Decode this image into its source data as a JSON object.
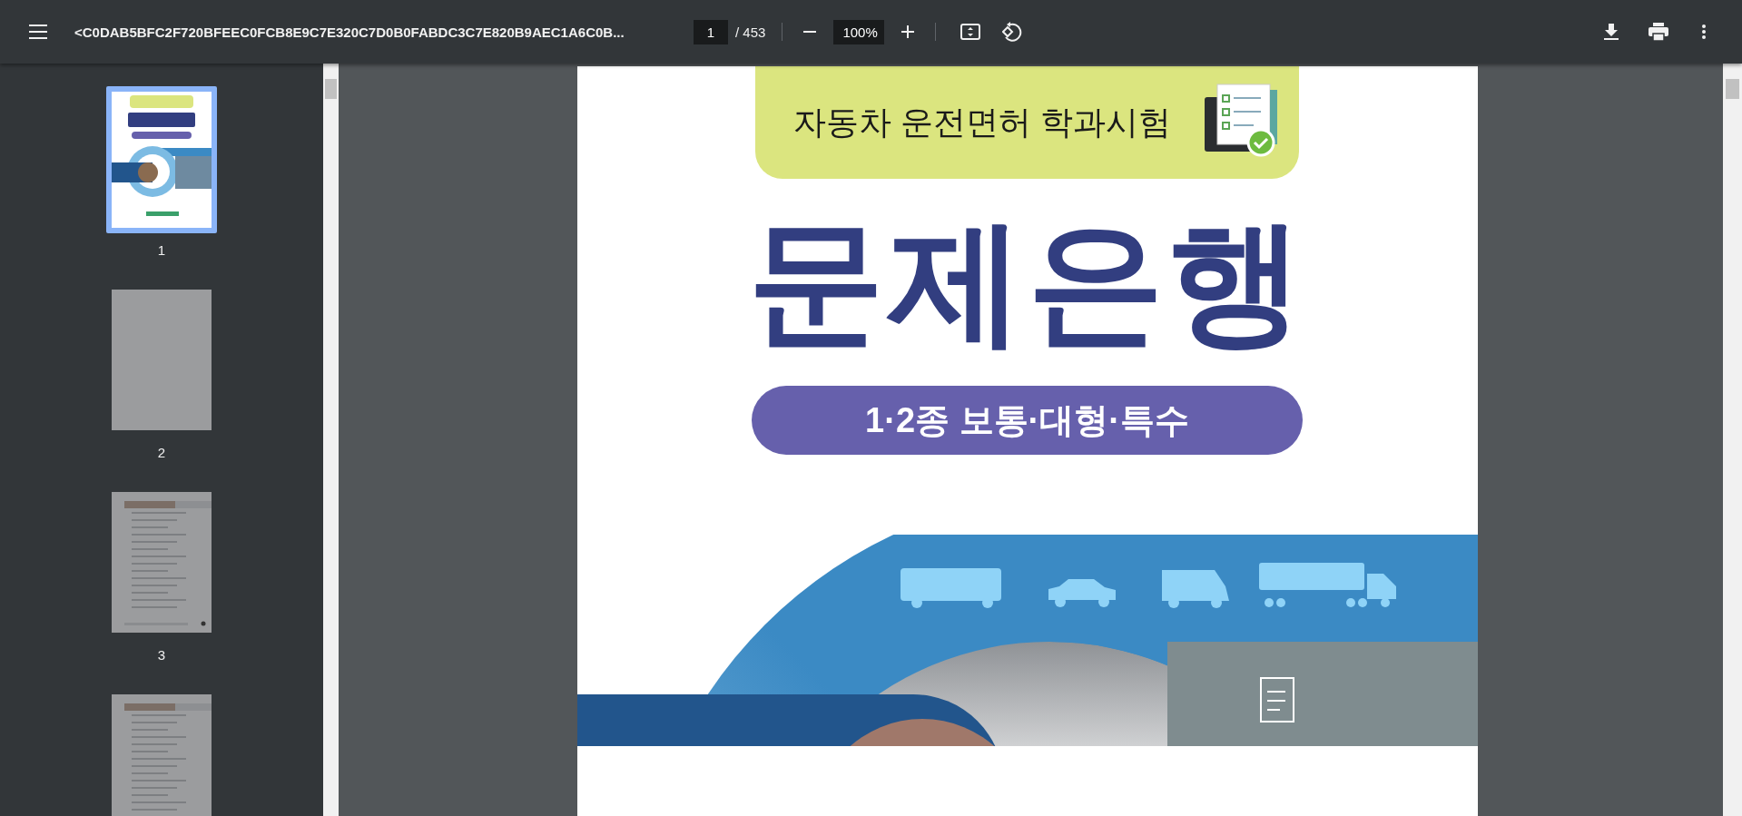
{
  "toolbar": {
    "title": "<C0DAB5BFC2F720BFEEC0FCB8E9C7E320C7D0B0FABDC3C7E820B9AEC1A6C0B...",
    "page_number": "1",
    "page_count": "/ 453",
    "zoom": "100%"
  },
  "thumbnails": [
    {
      "label": "1",
      "kind": "cover",
      "selected": true
    },
    {
      "label": "2",
      "kind": "blank",
      "selected": false
    },
    {
      "label": "3",
      "kind": "questions",
      "selected": false
    },
    {
      "kind": "questions",
      "selected": false
    }
  ],
  "document": {
    "banner": "자동차 운전면허 학과시험",
    "title": "문제은행",
    "subtitle": "1·2종 보통·대형·특수"
  }
}
